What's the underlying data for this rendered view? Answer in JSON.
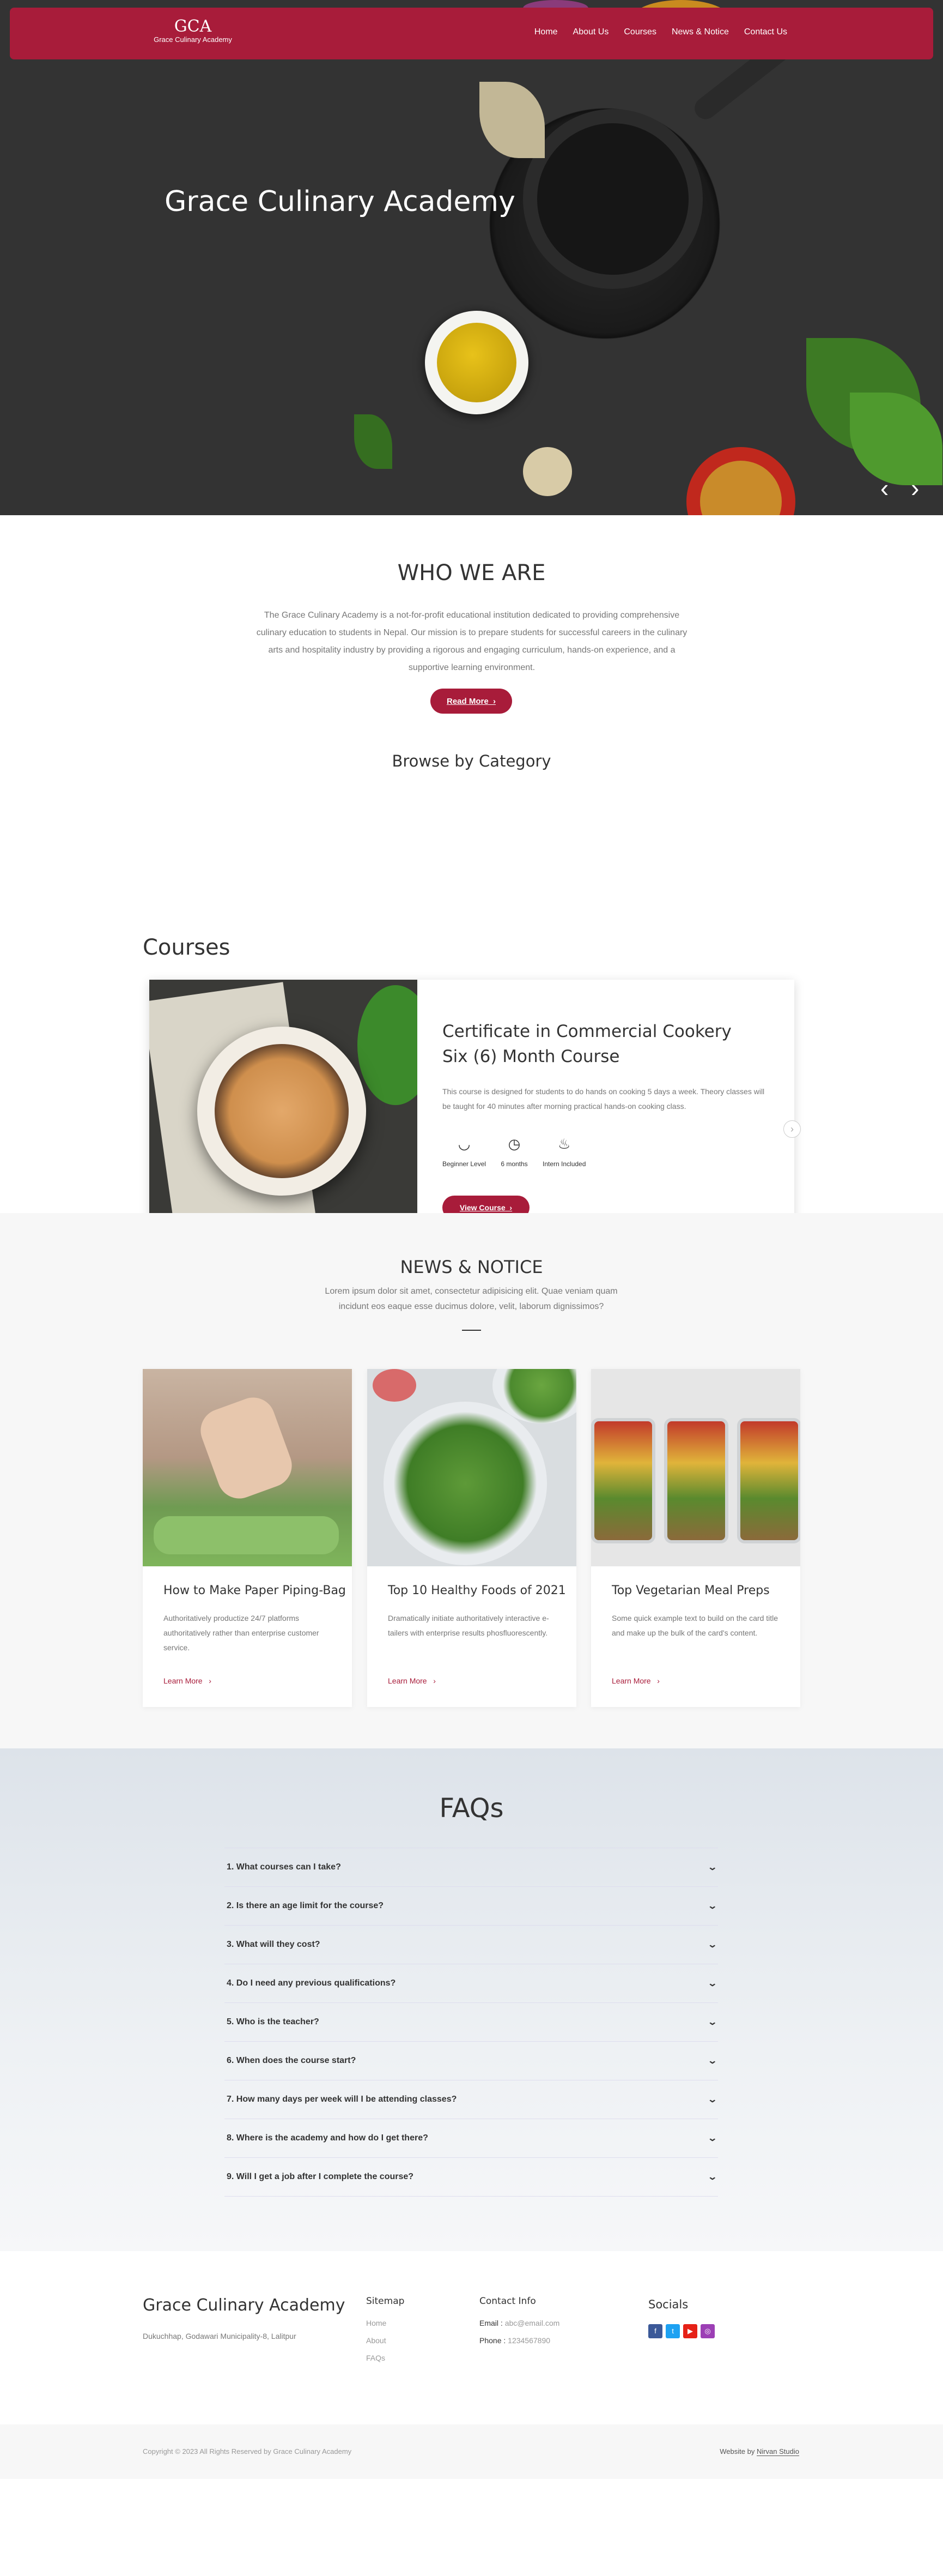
{
  "nav": {
    "logo_big": "GCA",
    "logo_small": "Grace Culinary Academy",
    "items": [
      "Home",
      "About Us",
      "Courses",
      "News & Notice",
      "Contact Us"
    ]
  },
  "hero": {
    "title": "Grace Culinary Academy",
    "prev_icon": "chevron-left-icon",
    "next_icon": "chevron-right-icon"
  },
  "who": {
    "title": "WHO WE ARE",
    "text": "The Grace Culinary Academy is a not-for-profit educational institution dedicated to providing comprehensive culinary education to students in Nepal. Our mission is to prepare students for successful careers in the culinary arts and hospitality industry by providing a rigorous and engaging curriculum, hands-on experience, and a supportive learning environment.",
    "read_more": "Read More",
    "browse_title": "Browse by Category"
  },
  "courses": {
    "title": "Courses",
    "card": {
      "title": "Certificate in Commercial Cookery Six (6) Month Course",
      "desc": "This course is designed for students to do hands on cooking 5 days a week. Theory classes will be taught for 40 minutes after morning practical hands-on cooking class.",
      "features": [
        {
          "icon": "bowl-icon",
          "label": "Beginner Level"
        },
        {
          "icon": "timer-icon",
          "label": "6 months"
        },
        {
          "icon": "chef-icon",
          "label": "Intern Included"
        }
      ],
      "button": "View Course"
    }
  },
  "news": {
    "title": "NEWS & NOTICE",
    "sub": "Lorem ipsum dolor sit amet, consectetur adipisicing elit. Quae veniam quam incidunt eos eaque esse ducimus dolore, velit, laborum dignissimos?",
    "items": [
      {
        "title": "How to Make Paper Piping-Bag",
        "text": "Authoritatively productize 24/7 platforms authoritatively rather than enterprise customer service.",
        "link": "Learn More"
      },
      {
        "title": "Top 10 Healthy Foods of 2021",
        "text": "Dramatically initiate authoritatively interactive e-tailers with enterprise results phosfluorescently.",
        "link": "Learn More"
      },
      {
        "title": "Top Vegetarian Meal Preps",
        "text": "Some quick example text to build on the card title and make up the bulk of the card's content.",
        "link": "Learn More"
      }
    ]
  },
  "faqs": {
    "title": "FAQs",
    "items": [
      "1. What courses can I take?",
      "2. Is there an age limit for the course?",
      "3. What will they cost?",
      "4. Do I need any previous qualifications?",
      "5. Who is the teacher?",
      "6. When does the course start?",
      "7. How many days per week will I be attending classes?",
      "8. Where is the academy and how do I get there?",
      "9. Will I get a job after I complete the course?"
    ]
  },
  "footer": {
    "brand": "Grace Culinary Academy",
    "address": "Dukuchhap, Godawari Municipality-8, Lalitpur",
    "sitemap_title": "Sitemap",
    "sitemap": [
      "Home",
      "About",
      "FAQs"
    ],
    "contact_title": "Contact Info",
    "email_label": "Email : ",
    "email": "abc@email.com",
    "phone_label": "Phone : ",
    "phone": "1234567890",
    "socials_title": "Socials",
    "socials": [
      {
        "icon": "facebook-icon",
        "color": "#3b5998",
        "glyph": "f"
      },
      {
        "icon": "twitter-icon",
        "color": "#1da1f2",
        "glyph": "t"
      },
      {
        "icon": "youtube-icon",
        "color": "#e62117",
        "glyph": "▶"
      },
      {
        "icon": "instagram-icon",
        "color": "#9c3fb5",
        "glyph": "◎"
      }
    ]
  },
  "bottom": {
    "copyright": "Copyright © 2023 All Rights Reserved by Grace Culinary Academy",
    "credit_prefix": "Website by ",
    "credit_link": "Nirvan Studio"
  },
  "colors": {
    "brand": "#a81c3a"
  }
}
